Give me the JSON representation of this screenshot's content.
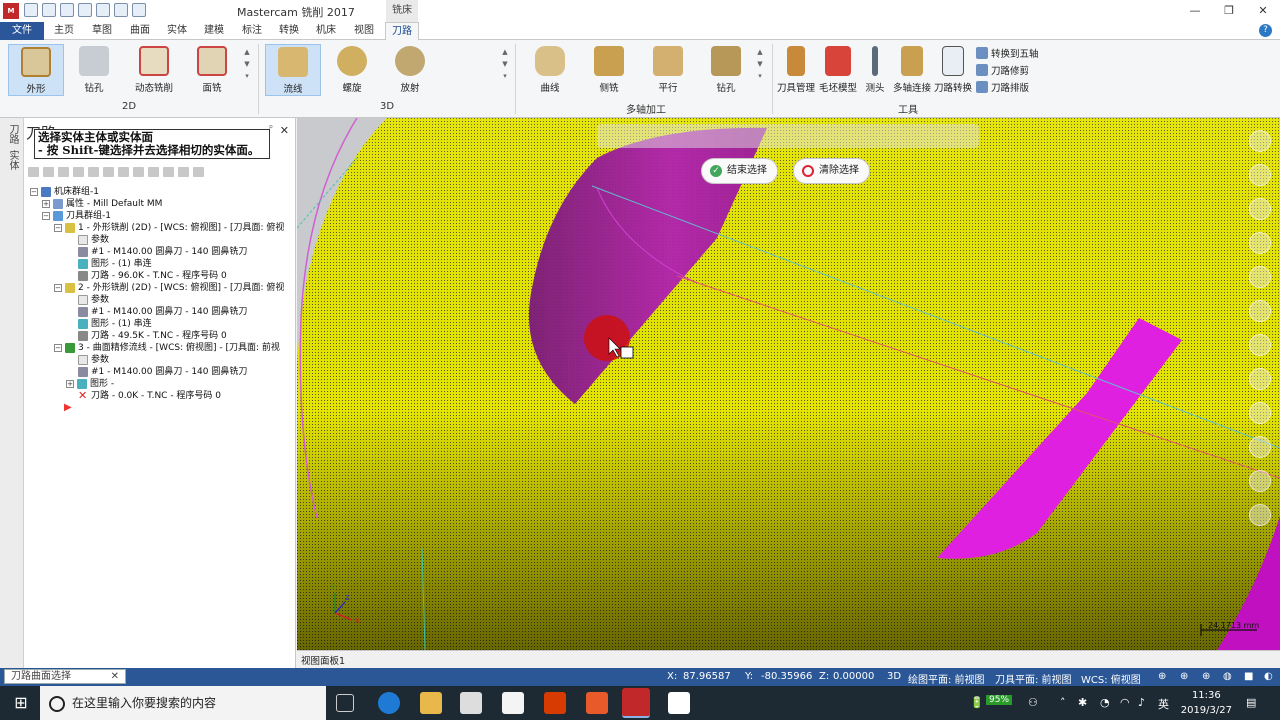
{
  "window": {
    "title": "Mastercam 铣削 2017",
    "context_tab": "铣床",
    "controls": [
      "—",
      "❐",
      "✕"
    ]
  },
  "tabs": [
    "文件",
    "主页",
    "草图",
    "曲面",
    "实体",
    "建模",
    "标注",
    "转换",
    "机床",
    "视图",
    "刀路"
  ],
  "ribbon": {
    "groups": {
      "g2d": "2D",
      "g3d": "3D",
      "multiaxis": "多轴加工",
      "tools": "工具"
    },
    "buttons": {
      "contour": "外形",
      "drill": "钻孔",
      "dynamic_mill": "动态铣削",
      "face": "面铣",
      "flowline": "流线",
      "spiral": "螺旋",
      "radial": "放射",
      "curve": "曲线",
      "swarf": "侧铣",
      "parallel": "平行",
      "drill5": "钻孔",
      "tool_manager": "刀具管理",
      "stock_model": "毛坯模型",
      "probe": "测头",
      "multiaxis_link": "多轴连接",
      "toolpath_transform": "刀路转换",
      "convert_5axis": "转换到五轴",
      "toolpath_trim": "刀路修剪",
      "toolpath_nest": "刀路排版"
    }
  },
  "left_strip": [
    "刀路",
    "实体"
  ],
  "panel": {
    "title": "刀路",
    "tooltip_line1": "选择实体主体或实体面",
    "tooltip_line2": "- 按 Shift-键选择并去选择相切的实体面。",
    "tree": [
      "机床群组-1",
      "属性 - Mill Default MM",
      "刀具群组-1",
      "1 - 外形铣削 (2D) - [WCS: 俯视图] - [刀具面: 俯视",
      "参数",
      "#1 - M140.00 圆鼻刀 - 140 圆鼻铣刀",
      "图形 - (1) 串连",
      "刀路 - 96.0K - T.NC - 程序号码 0",
      "2 - 外形铣削 (2D) - [WCS: 俯视图] - [刀具面: 俯视",
      "参数",
      "#1 - M140.00 圆鼻刀 - 140 圆鼻铣刀",
      "图形 - (1) 串连",
      "刀路 - 49.5K - T.NC - 程序号码 0",
      "3 - 曲面精修流线 - [WCS: 俯视图] - [刀具面: 前视",
      "参数",
      "#1 - M140.00 圆鼻刀 - 140 圆鼻铣刀",
      "图形 -",
      "刀路 - 0.0K - T.NC - 程序号码 0"
    ]
  },
  "viewport": {
    "end_selection": "结束选择",
    "clear_selection": "清除选择",
    "view_tab": "视图面板1",
    "scale_label": "24.1713 mm"
  },
  "status": {
    "search_value": "刀路曲面选择",
    "x_label": "X:",
    "x_value": "87.96587",
    "y_label": "Y:",
    "y_value": "-80.35966",
    "z_label": "Z:",
    "z_value": "0.00000",
    "mode": "3D",
    "cplane": "绘图平面: 前视图",
    "tplane": "刀具平面: 前视图",
    "wcs": "WCS: 俯视图"
  },
  "taskbar": {
    "search_placeholder": "在这里输入你要搜索的内容",
    "battery": "95%",
    "ime": "英",
    "time": "11:36",
    "date": "2019/3/27"
  },
  "colors": {
    "part_yellow": "#e6e600",
    "face_magenta": "#dd22dd",
    "status_blue": "#2b5797",
    "ribbon_bg": "#f5f6f7"
  }
}
